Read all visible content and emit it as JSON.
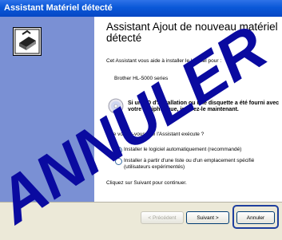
{
  "window": {
    "title": "Assistant Matériel détecté"
  },
  "wizard": {
    "heading": "Assistant Ajout de nouveau matériel détecté",
    "intro": "Cet Assistant vous aide à installer le logiciel pour :",
    "device": "Brother HL-5000 series",
    "cd_notice": "Si un CD d'installation ou une disquette a été fourni avec votre périphérique, insérez-le maintenant.",
    "question": "Que voulez-vous que l'Assistant exécute ?",
    "options": [
      {
        "label": "Installer le logiciel automatiquement (recommandé)",
        "selected": true
      },
      {
        "label": "Installer à partir d'une liste ou d'un emplacement spécifié (utilisateurs expérimentés)",
        "selected": false
      }
    ],
    "continue_hint": "Cliquez sur Suivant pour continuer."
  },
  "buttons": {
    "back": "< Précédent",
    "next": "Suivant >",
    "cancel": "Annuler"
  },
  "watermark": {
    "text": "ANNULER",
    "color": "#0a0aa0"
  },
  "colors": {
    "titlebar": "#0a58d8",
    "side_panel": "#7a90d4",
    "footer": "#ece9d8",
    "highlight": "#1f3f9e"
  }
}
